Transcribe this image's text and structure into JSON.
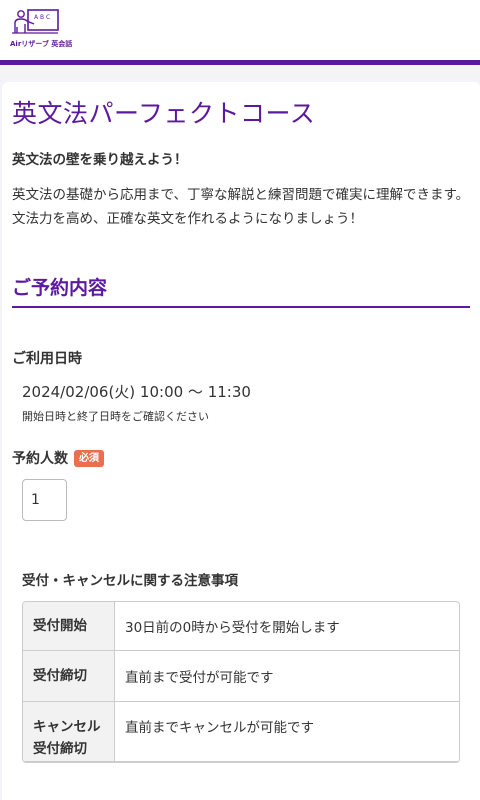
{
  "header": {
    "logo_text": "Airリザーブ 英会話",
    "logo_board": "A B C"
  },
  "course": {
    "title": "英文法パーフェクトコース",
    "lead": "英文法の壁を乗り越えよう！",
    "description_1": "英文法の基礎から応用まで、丁寧な解説と練習問題で確実に理解できます。",
    "description_2": "文法力を高め、正確な英文を作れるようになりましょう！"
  },
  "reservation": {
    "section_title": "ご予約内容",
    "usage_label": "ご利用日時",
    "datetime": "2024/02/06(火) 10:00 〜 11:30",
    "datetime_note": "開始日時と終了日時をご確認ください",
    "people_label": "予約人数",
    "required_badge": "必須",
    "people_value": "1"
  },
  "notice": {
    "title": "受付・キャンセルに関する注意事項",
    "rows": [
      {
        "label": "受付開始",
        "value": "30日前の0時から受付を開始します"
      },
      {
        "label": "受付締切",
        "value": "直前まで受付が可能です"
      },
      {
        "label_line1": "キャンセル",
        "label_line2": "受付締切",
        "value": "直前までキャンセルが可能です"
      }
    ]
  },
  "colors": {
    "brand": "#5b1a9e",
    "required_badge": "#ed6d4f"
  }
}
